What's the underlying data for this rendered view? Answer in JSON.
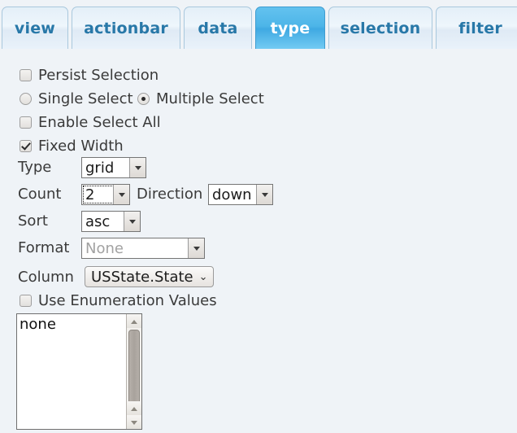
{
  "tabs": [
    {
      "id": "view",
      "label": "view",
      "active": false
    },
    {
      "id": "actionbar",
      "label": "actionbar",
      "active": false
    },
    {
      "id": "data",
      "label": "data",
      "active": false
    },
    {
      "id": "type",
      "label": "type",
      "active": true
    },
    {
      "id": "selection",
      "label": "selection",
      "active": false
    },
    {
      "id": "filter",
      "label": "filter",
      "active": false
    }
  ],
  "panel": {
    "persist_selection": {
      "label": "Persist Selection",
      "checked": false
    },
    "select_mode": {
      "single_label": "Single Select",
      "multiple_label": "Multiple Select",
      "selected": "Multiple Select"
    },
    "enable_select_all": {
      "label": "Enable Select All",
      "checked": false
    },
    "fixed_width": {
      "label": "Fixed Width",
      "checked": true
    },
    "type": {
      "label": "Type",
      "value": "grid"
    },
    "count": {
      "label": "Count",
      "value": "2"
    },
    "direction": {
      "label": "Direction",
      "value": "down"
    },
    "sort": {
      "label": "Sort",
      "value": "asc"
    },
    "format": {
      "label": "Format",
      "value": "None"
    },
    "column": {
      "label": "Column",
      "value": "USState.State",
      "chevron": "⌄"
    },
    "use_enumeration_values": {
      "label": "Use Enumeration Values",
      "checked": false
    },
    "enumeration_list": {
      "items": [
        "none"
      ]
    }
  },
  "colors": {
    "background": "#eff3f7",
    "tab_active_bg": "#4db5e8",
    "tab_inactive_text": "#2878a8",
    "tab_active_text": "#ffffff",
    "text": "#3a3a3a",
    "disabled_text": "#a2a2a2"
  }
}
